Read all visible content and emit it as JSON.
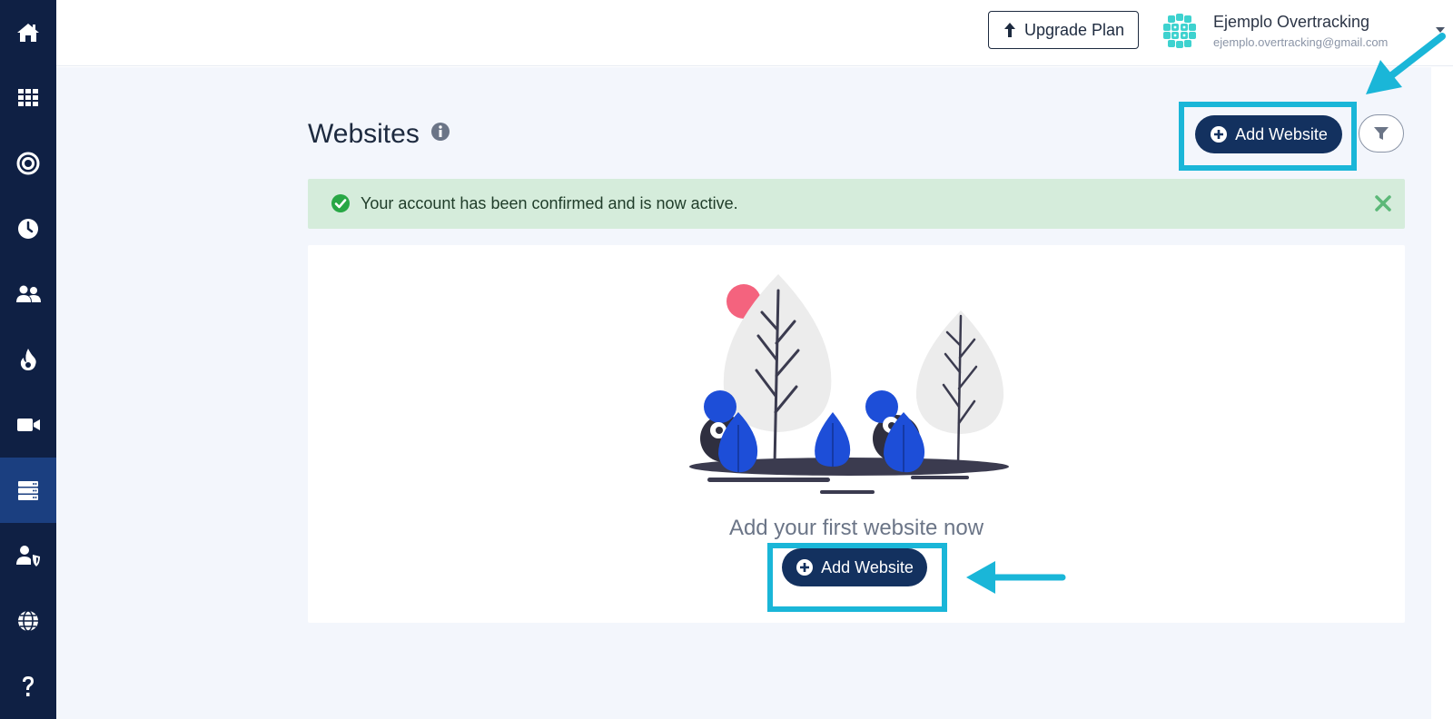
{
  "sidebar": {
    "items": [
      {
        "icon": "home-icon",
        "active": false
      },
      {
        "icon": "grid-icon",
        "active": false
      },
      {
        "icon": "target-icon",
        "active": false
      },
      {
        "icon": "clock-icon",
        "active": false
      },
      {
        "icon": "users-icon",
        "active": false
      },
      {
        "icon": "fire-icon",
        "active": false
      },
      {
        "icon": "video-camera-icon",
        "active": false
      },
      {
        "icon": "server-icon",
        "active": true
      },
      {
        "icon": "user-shield-icon",
        "active": false
      },
      {
        "icon": "globe-icon",
        "active": false
      },
      {
        "icon": "question-icon",
        "active": false
      }
    ]
  },
  "header": {
    "upgrade_label": "Upgrade Plan",
    "user": {
      "name": "Ejemplo Overtracking",
      "email": "ejemplo.overtracking@gmail.com"
    }
  },
  "page": {
    "title": "Websites",
    "add_website_label": "Add Website"
  },
  "alert": {
    "message": "Your account has been confirmed and is now active."
  },
  "empty_state": {
    "message": "Add your first website now",
    "button_label": "Add Website"
  },
  "colors": {
    "sidebar_bg": "#0f2044",
    "sidebar_active": "#1b3f80",
    "primary_button": "#13315f",
    "alert_bg": "#d5ecdb",
    "success_green": "#28a745",
    "highlight_cyan": "#1ab6d8",
    "accent_pink": "#f4637e",
    "illustration_blue": "#1d4ed8"
  }
}
